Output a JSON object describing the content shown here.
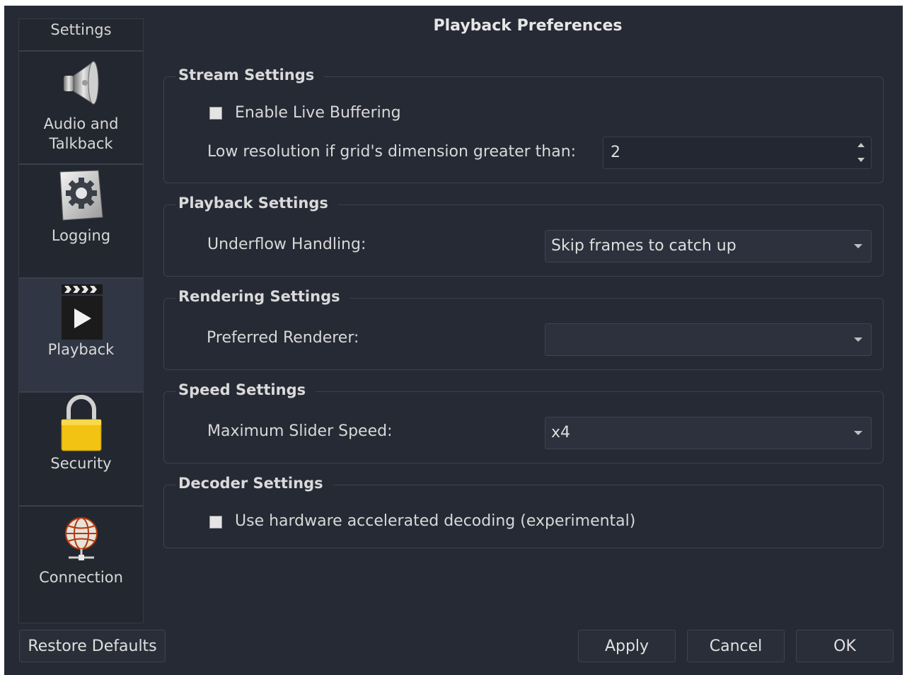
{
  "sidebar": {
    "header": "Settings",
    "items": [
      {
        "label_line1": "Audio and",
        "label_line2": "Talkback",
        "icon": "speaker-icon"
      },
      {
        "label": "Logging",
        "icon": "gear-icon"
      },
      {
        "label": "Playback",
        "icon": "clapperboard-play-icon"
      },
      {
        "label": "Security",
        "icon": "padlock-icon"
      },
      {
        "label": "Connection",
        "icon": "globe-network-icon"
      }
    ],
    "active_item": "Playback"
  },
  "title": "Playback Preferences",
  "stream": {
    "title": "Stream Settings",
    "live_buffering_label": "Enable Live Buffering",
    "live_buffering_checked": false,
    "low_res_label": "Low resolution if grid's dimension greater than:",
    "low_res_value": "2"
  },
  "playback": {
    "title": "Playback Settings",
    "underflow_label": "Underflow Handling:",
    "underflow_value": "Skip frames to catch up"
  },
  "rendering": {
    "title": "Rendering Settings",
    "renderer_label": "Preferred Renderer:",
    "renderer_value": ""
  },
  "speed": {
    "title": "Speed Settings",
    "max_speed_label": "Maximum Slider Speed:",
    "max_speed_value": "x4"
  },
  "decoder": {
    "title": "Decoder Settings",
    "hw_decoding_label": "Use hardware accelerated decoding (experimental)",
    "hw_decoding_checked": false
  },
  "buttons": {
    "restore": "Restore Defaults",
    "apply": "Apply",
    "cancel": "Cancel",
    "ok": "OK"
  },
  "colors": {
    "background": "#262a35",
    "sidebar": "#232730",
    "active_item": "#313644",
    "padlock": "#f2c312"
  }
}
